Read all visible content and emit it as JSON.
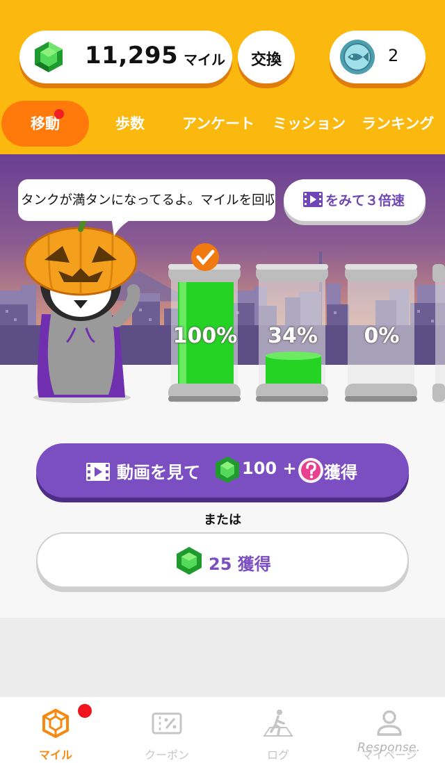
{
  "header": {
    "miles_value": "11,295",
    "miles_unit": "マイル",
    "exchange_label": "交換",
    "coin_count": "2",
    "icons": {
      "miles": "emerald-gem-icon",
      "coin": "fish-coin-icon"
    }
  },
  "tabs": [
    {
      "label": "移動",
      "active": true,
      "badge": true
    },
    {
      "label": "歩数"
    },
    {
      "label": "アンケート"
    },
    {
      "label": "ミッション"
    },
    {
      "label": "ランキング"
    }
  ],
  "scene": {
    "speech": "タンクが満タンになってるよ。マイルを回収しよう",
    "speed_button": "をみて３倍速",
    "tanks": [
      {
        "label": "100%",
        "fill": 1.0,
        "checked": true
      },
      {
        "label": "34%",
        "fill": 0.34
      },
      {
        "label": "0%",
        "fill": 0.0
      }
    ]
  },
  "actions": {
    "video_label_a": "動画を見て",
    "video_label_b": "100 +",
    "video_label_c": "獲得",
    "or_text": "または",
    "earn_label": "25 獲得"
  },
  "bottom_nav": [
    {
      "label": "マイル",
      "icon": "hexagon-icon",
      "active": true,
      "badge": true
    },
    {
      "label": "クーポン",
      "icon": "coupon-percent-icon"
    },
    {
      "label": "ログ",
      "icon": "walking-person-icon"
    },
    {
      "label": "マイページ",
      "icon": "person-icon"
    }
  ],
  "watermark": "Response.",
  "colors": {
    "header_bg": "#fbb80f",
    "tab_active": "#ff7a0b",
    "primary_purple": "#7b4fc1",
    "gem_green": "#2fbf43",
    "badge_red": "#f0141e",
    "nav_active": "#f58a12"
  }
}
